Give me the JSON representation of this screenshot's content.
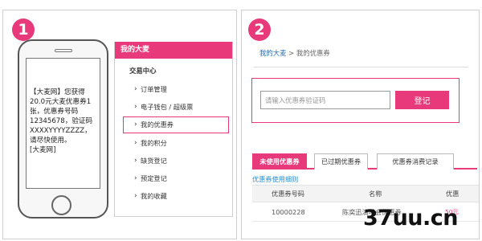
{
  "steps": [
    "1",
    "2"
  ],
  "colors": {
    "accent": "#e8397a",
    "link": "#2b6cb0"
  },
  "phone": {
    "sms_lines": [
      "【大麦网】您获得",
      "20.0元大麦优惠券1",
      "张，优惠券号码",
      "12345678，验证码",
      "XXXXYYYYZZZZ，",
      "请尽快使用。",
      "[大麦网]"
    ]
  },
  "sidebar": {
    "header": "我的大麦",
    "section": "交易中心",
    "items": [
      {
        "label": "订单管理",
        "active": false
      },
      {
        "label": "电子钱包 / 超级票",
        "active": false
      },
      {
        "label": "我的优惠券",
        "active": true
      },
      {
        "label": "我的积分",
        "active": false
      },
      {
        "label": "缺货登记",
        "active": false
      },
      {
        "label": "预定登记",
        "active": false
      },
      {
        "label": "我的收藏",
        "active": false
      }
    ]
  },
  "breadcrumb": {
    "home": "我的大麦",
    "separator": ">",
    "current": "我的优惠券"
  },
  "voucher_form": {
    "placeholder": "请输入优惠券验证码",
    "button": "登记"
  },
  "tabs": [
    "未使用优惠券",
    "已过期优惠券",
    "优惠券消费记录"
  ],
  "rules_link": "优惠券使用细则",
  "table": {
    "headers": [
      "优惠券号码",
      "名称",
      "优惠"
    ],
    "rows": [
      {
        "number": "10000228",
        "name": "陈奕迅演唱会优惠券",
        "amount": "50元"
      }
    ]
  },
  "watermark": "37uu.cn"
}
